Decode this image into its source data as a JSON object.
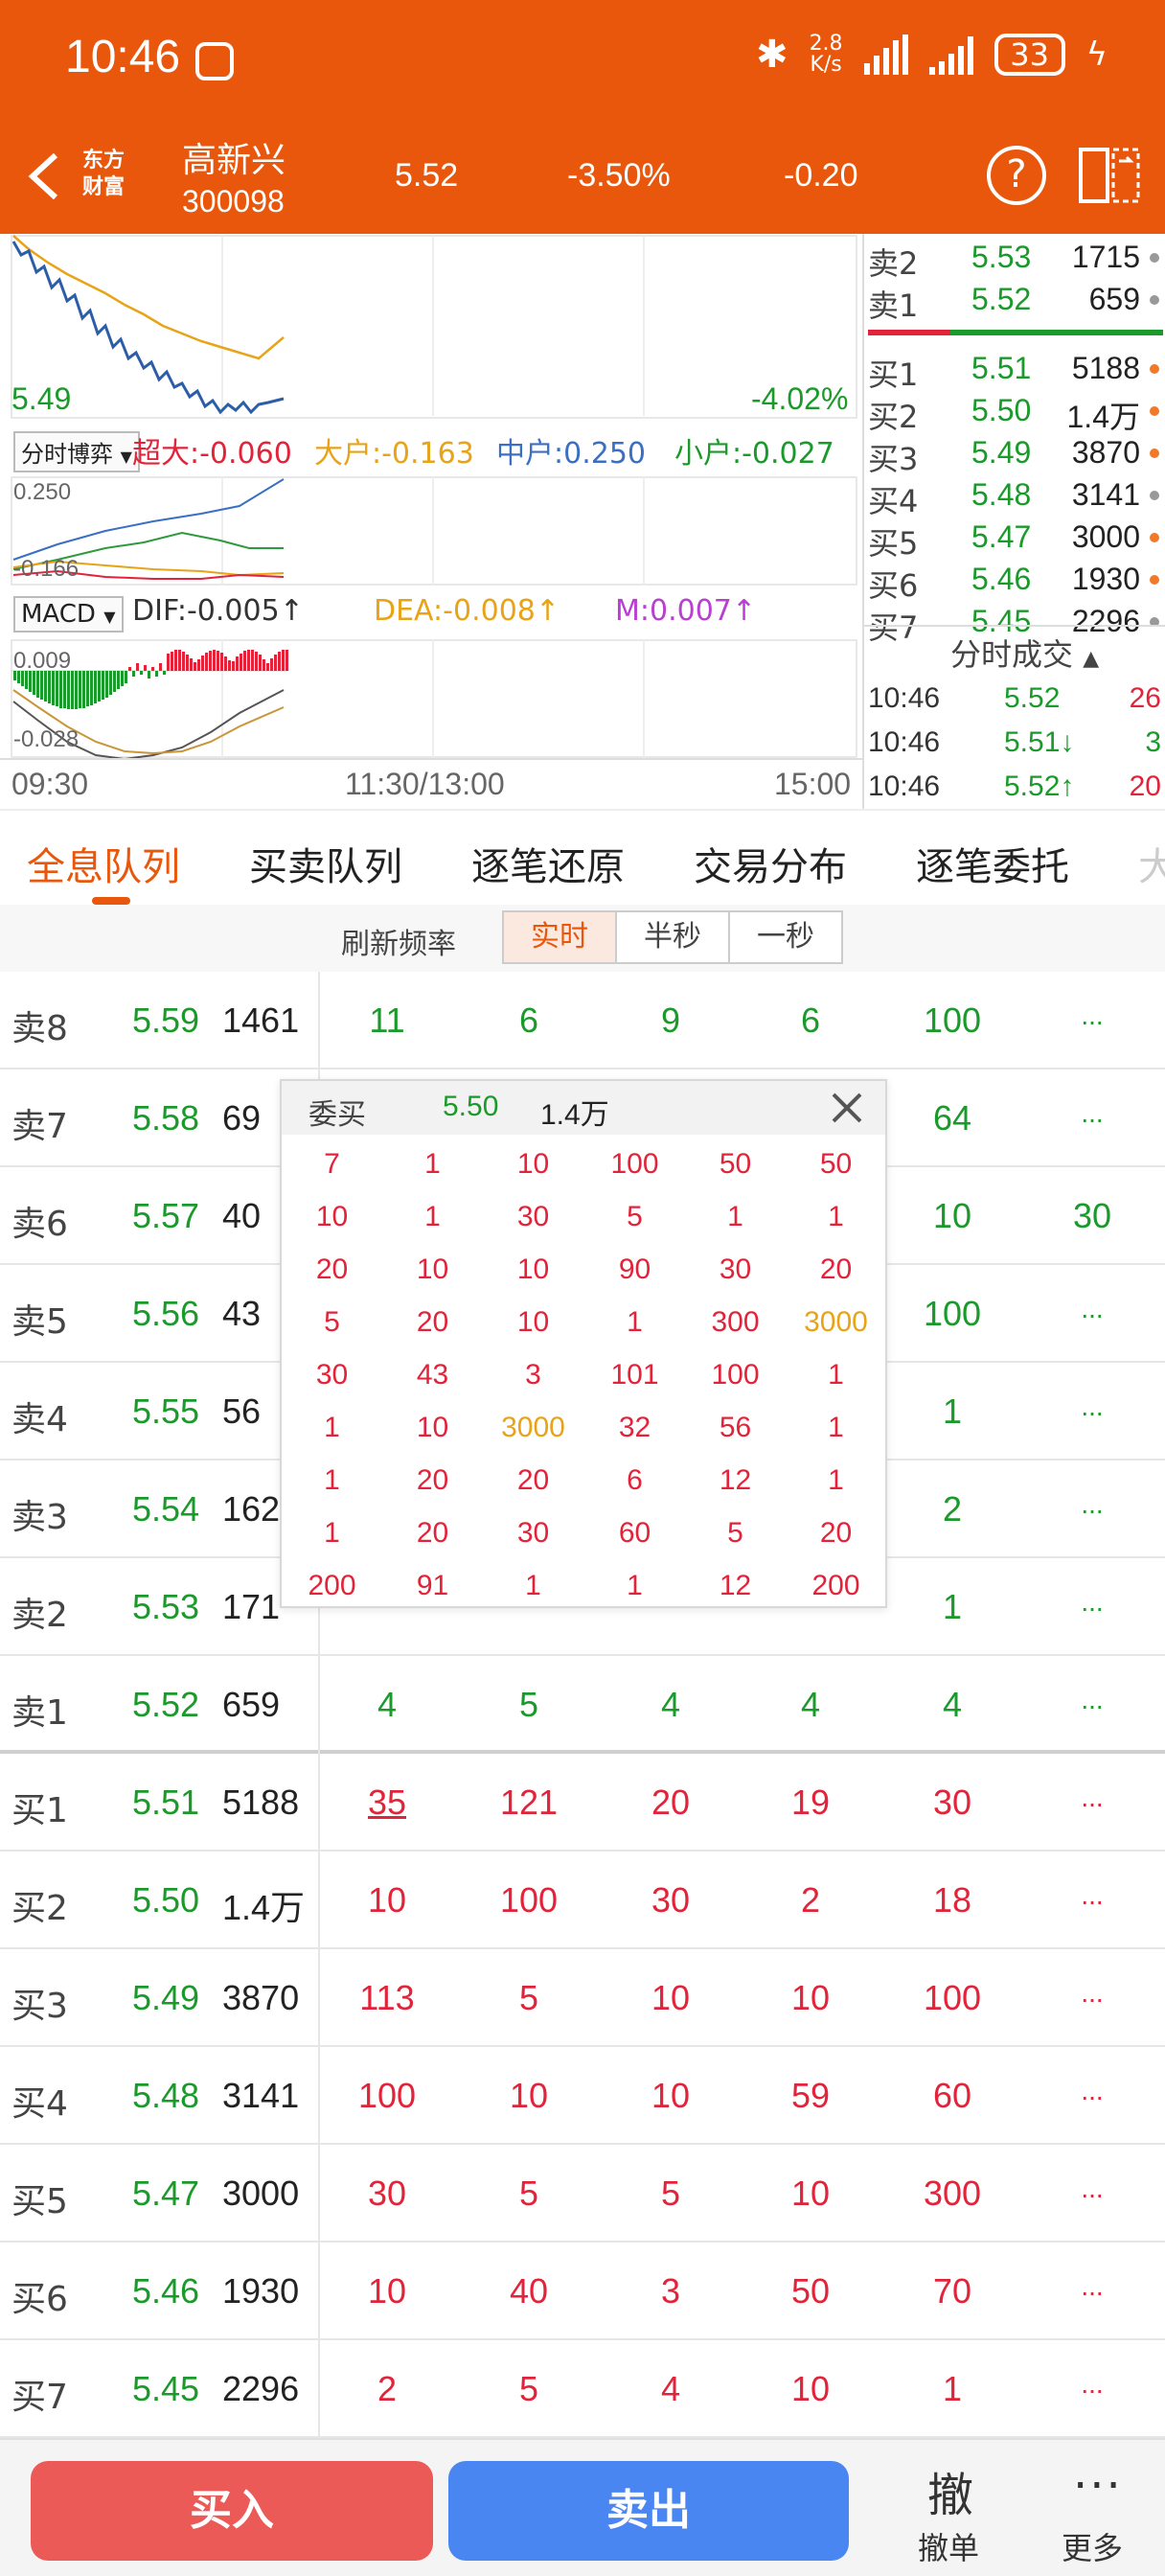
{
  "status": {
    "time": "10:46",
    "net_speed_top": "2.8",
    "net_speed_bottom": "K/s",
    "battery": "33"
  },
  "header": {
    "logo": "东方财富",
    "stock_name": "高新兴",
    "stock_code": "300098",
    "price": "5.52",
    "change_pct": "-3.50%",
    "change": "-0.20",
    "help": "?"
  },
  "chart": {
    "price_label": "5.49",
    "pct_label": "-4.02%",
    "indicator_selector": "分时博弈",
    "flow": {
      "super": "超大:-0.060",
      "large": "大户:-0.163",
      "mid": "中户:0.250",
      "small": "小户:-0.027"
    },
    "flow_max": "0.250",
    "flow_min": "-0.166",
    "macd_selector": "MACD",
    "dif": "DIF:-0.005↑",
    "dea": "DEA:-0.008↑",
    "m": "M:0.007↑",
    "macd_max": "0.009",
    "macd_min": "-0.028",
    "time_start": "09:30",
    "time_mid": "11:30/13:00",
    "time_end": "15:00"
  },
  "book": {
    "sells": [
      {
        "label": "卖2",
        "price": "5.53",
        "vol": "1715",
        "dot": "#999999"
      },
      {
        "label": "卖1",
        "price": "5.52",
        "vol": "659",
        "dot": "#999999"
      }
    ],
    "buys": [
      {
        "label": "买1",
        "price": "5.51",
        "vol": "5188",
        "dot": "#f07a2a"
      },
      {
        "label": "买2",
        "price": "5.50",
        "vol": "1.4万",
        "dot": "#f07a2a"
      },
      {
        "label": "买3",
        "price": "5.49",
        "vol": "3870",
        "dot": "#f07a2a"
      },
      {
        "label": "买4",
        "price": "5.48",
        "vol": "3141",
        "dot": "#999999"
      },
      {
        "label": "买5",
        "price": "5.47",
        "vol": "3000",
        "dot": "#f07a2a"
      },
      {
        "label": "买6",
        "price": "5.46",
        "vol": "1930",
        "dot": "#f07a2a"
      },
      {
        "label": "买7",
        "price": "5.45",
        "vol": "2296",
        "dot": "#999999"
      }
    ],
    "ticks_title": "分时成交",
    "ticks": [
      {
        "time": "10:46",
        "price": "5.52",
        "vol": "26",
        "pc": "green",
        "vc": "red"
      },
      {
        "time": "10:46",
        "price": "5.51↓",
        "vol": "3",
        "pc": "green",
        "vc": "green"
      },
      {
        "time": "10:46",
        "price": "5.52↑",
        "vol": "20",
        "pc": "green",
        "vc": "red"
      }
    ]
  },
  "tabs": [
    "全息队列",
    "买卖队列",
    "逐笔还原",
    "交易分布",
    "逐笔委托",
    "大"
  ],
  "refresh": {
    "label": "刷新频率",
    "options": [
      "实时",
      "半秒",
      "一秒"
    ]
  },
  "queue": [
    {
      "label": "卖8",
      "price": "5.59",
      "vol": "1461",
      "side": "sell",
      "cells": [
        "11",
        "6",
        "9",
        "6",
        "100",
        "..."
      ]
    },
    {
      "label": "卖7",
      "price": "5.58",
      "vol": "69",
      "side": "sell",
      "cells": [
        "",
        "",
        "",
        "",
        "64",
        "..."
      ]
    },
    {
      "label": "卖6",
      "price": "5.57",
      "vol": "40",
      "side": "sell",
      "cells": [
        "",
        "",
        "",
        "",
        "10",
        "30"
      ]
    },
    {
      "label": "卖5",
      "price": "5.56",
      "vol": "43",
      "side": "sell",
      "cells": [
        "",
        "",
        "",
        "",
        "100",
        "..."
      ]
    },
    {
      "label": "卖4",
      "price": "5.55",
      "vol": "56",
      "side": "sell",
      "cells": [
        "",
        "",
        "",
        "",
        "1",
        "..."
      ]
    },
    {
      "label": "卖3",
      "price": "5.54",
      "vol": "162",
      "side": "sell",
      "cells": [
        "",
        "",
        "",
        "",
        "2",
        "..."
      ]
    },
    {
      "label": "卖2",
      "price": "5.53",
      "vol": "171",
      "side": "sell",
      "cells": [
        "",
        "",
        "",
        "",
        "1",
        "..."
      ]
    },
    {
      "label": "卖1",
      "price": "5.52",
      "vol": "659",
      "side": "sell",
      "cells": [
        "4",
        "5",
        "4",
        "4",
        "4",
        "..."
      ]
    },
    {
      "label": "买1",
      "price": "5.51",
      "vol": "5188",
      "side": "buy",
      "cells": [
        "35",
        "121",
        "20",
        "19",
        "30",
        "..."
      ]
    },
    {
      "label": "买2",
      "price": "5.50",
      "vol": "1.4万",
      "side": "buy",
      "cells": [
        "10",
        "100",
        "30",
        "2",
        "18",
        "..."
      ]
    },
    {
      "label": "买3",
      "price": "5.49",
      "vol": "3870",
      "side": "buy",
      "cells": [
        "113",
        "5",
        "10",
        "10",
        "100",
        "..."
      ]
    },
    {
      "label": "买4",
      "price": "5.48",
      "vol": "3141",
      "side": "buy",
      "cells": [
        "100",
        "10",
        "10",
        "59",
        "60",
        "..."
      ]
    },
    {
      "label": "买5",
      "price": "5.47",
      "vol": "3000",
      "side": "buy",
      "cells": [
        "30",
        "5",
        "5",
        "10",
        "300",
        "..."
      ]
    },
    {
      "label": "买6",
      "price": "5.46",
      "vol": "1930",
      "side": "buy",
      "cells": [
        "10",
        "40",
        "3",
        "50",
        "70",
        "..."
      ]
    },
    {
      "label": "买7",
      "price": "5.45",
      "vol": "2296",
      "side": "buy",
      "cells": [
        "2",
        "5",
        "4",
        "10",
        "1",
        "..."
      ]
    }
  ],
  "popup": {
    "title": "委买",
    "price": "5.50",
    "vol": "1.4万",
    "rows": [
      [
        "7",
        "1",
        "10",
        "100",
        "50",
        "50"
      ],
      [
        "10",
        "1",
        "30",
        "5",
        "1",
        "1"
      ],
      [
        "20",
        "10",
        "10",
        "90",
        "30",
        "20"
      ],
      [
        "5",
        "20",
        "10",
        "1",
        "300",
        "3000"
      ],
      [
        "30",
        "43",
        "3",
        "101",
        "100",
        "1"
      ],
      [
        "1",
        "10",
        "3000",
        "32",
        "56",
        "1"
      ],
      [
        "1",
        "20",
        "20",
        "6",
        "12",
        "1"
      ],
      [
        "1",
        "20",
        "30",
        "60",
        "5",
        "20"
      ],
      [
        "200",
        "91",
        "1",
        "1",
        "12",
        "200"
      ]
    ],
    "highlight_values": [
      "3000"
    ]
  },
  "bottom": {
    "buy": "买入",
    "sell": "卖出",
    "cancel_icon": "撤",
    "cancel": "撤单",
    "more_icon": "···",
    "more": "更多"
  },
  "colors": {
    "brand": "#e9570c",
    "up": "#e2233a",
    "down": "#1a9a2a",
    "highlight": "#e8a317"
  }
}
